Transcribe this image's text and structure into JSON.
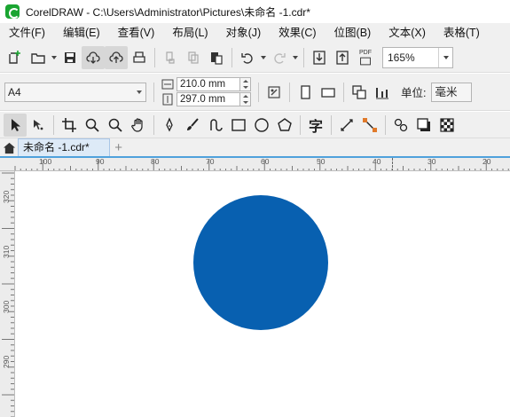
{
  "window": {
    "title": "CorelDRAW - C:\\Users\\Administrator\\Pictures\\未命名 -1.cdr*"
  },
  "menu": [
    {
      "label": "文件(F)"
    },
    {
      "label": "编辑(E)"
    },
    {
      "label": "查看(V)"
    },
    {
      "label": "布局(L)"
    },
    {
      "label": "对象(J)"
    },
    {
      "label": "效果(C)"
    },
    {
      "label": "位图(B)"
    },
    {
      "label": "文本(X)"
    },
    {
      "label": "表格(T)"
    }
  ],
  "toolbar": {
    "zoom": "165%",
    "pdf_label": "PDF"
  },
  "property_bar": {
    "page_size": "A4",
    "width": "210.0 mm",
    "height": "297.0 mm",
    "units_label": "单位:",
    "units_value": "毫米"
  },
  "tabs": {
    "document": "未命名 -1.cdr*",
    "add": "+"
  },
  "ruler_h": [
    "100",
    "90",
    "80",
    "70",
    "60",
    "50",
    "40",
    "30",
    "20"
  ],
  "ruler_v": [
    "320",
    "310",
    "300",
    "290"
  ],
  "canvas": {
    "circle_color": "#0860b0"
  },
  "colors": {
    "accent": "#4fa1dc",
    "brand": "#1aa531"
  }
}
